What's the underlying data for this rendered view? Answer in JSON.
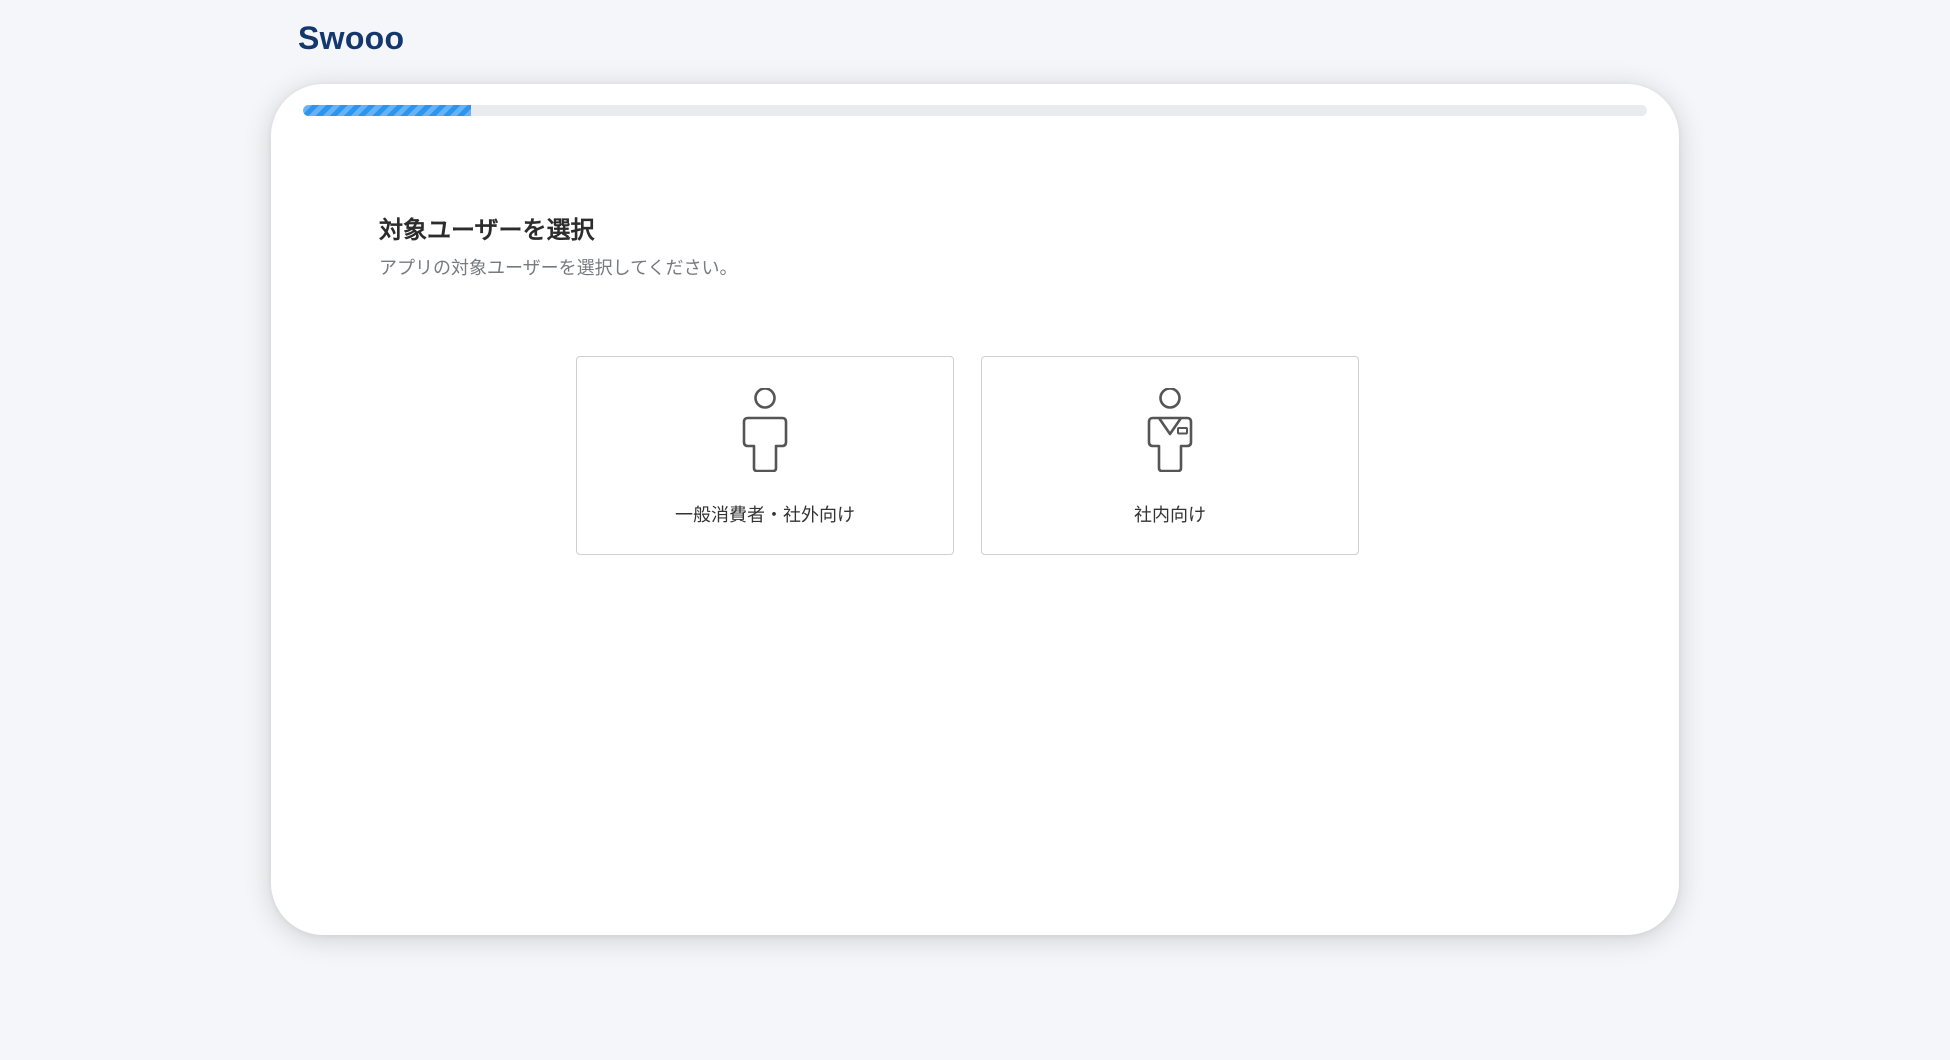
{
  "app": {
    "logo_text": "Swooo"
  },
  "progress": {
    "fraction": 0.125,
    "accent_color": "#2e95ee"
  },
  "step": {
    "title": "対象ユーザーを選択",
    "description": "アプリの対象ユーザーを選択してください。"
  },
  "options": [
    {
      "label": "一般消費者・社外向け",
      "icon": "person-icon"
    },
    {
      "label": "社内向け",
      "icon": "person-with-badge-icon"
    }
  ]
}
